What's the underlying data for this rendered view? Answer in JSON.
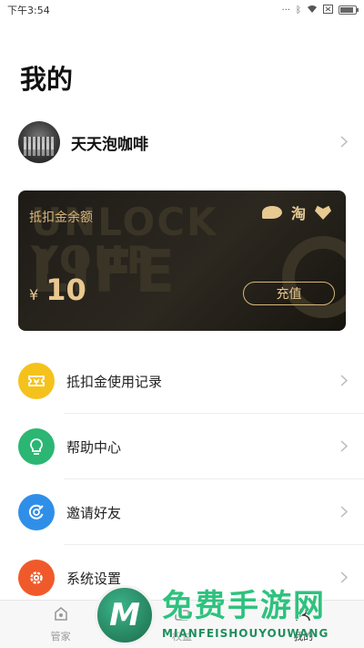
{
  "status_bar": {
    "time": "下午3:54",
    "battery_level": 0.85
  },
  "page": {
    "title": "我的"
  },
  "profile": {
    "username": "天天泡咖啡"
  },
  "card": {
    "label": "抵扣金余额",
    "logo_text": "淘",
    "currency": "¥",
    "amount": "10",
    "recharge_label": "充值",
    "background_text_1": "UNLOCK YOUR",
    "background_text_2": "LIFE"
  },
  "menu": [
    {
      "label": "抵扣金使用记录",
      "icon": "ticket-icon",
      "color": "#F5C21B"
    },
    {
      "label": "帮助中心",
      "icon": "lightbulb-icon",
      "color": "#2BB673"
    },
    {
      "label": "邀请好友",
      "icon": "invite-icon",
      "color": "#2F8FE8"
    },
    {
      "label": "系统设置",
      "icon": "gear-icon",
      "color": "#F05A2A"
    }
  ],
  "bottom_nav": [
    {
      "label": "管家",
      "icon": "butler-icon",
      "active": false
    },
    {
      "label": "权益",
      "icon": "benefits-icon",
      "active": false
    },
    {
      "label": "我的",
      "icon": "profile-icon",
      "active": true
    }
  ],
  "watermark": {
    "title": "免费手游网",
    "subtitle": "MIANFEISHOUYOUWANG",
    "logo_letter": "M"
  }
}
